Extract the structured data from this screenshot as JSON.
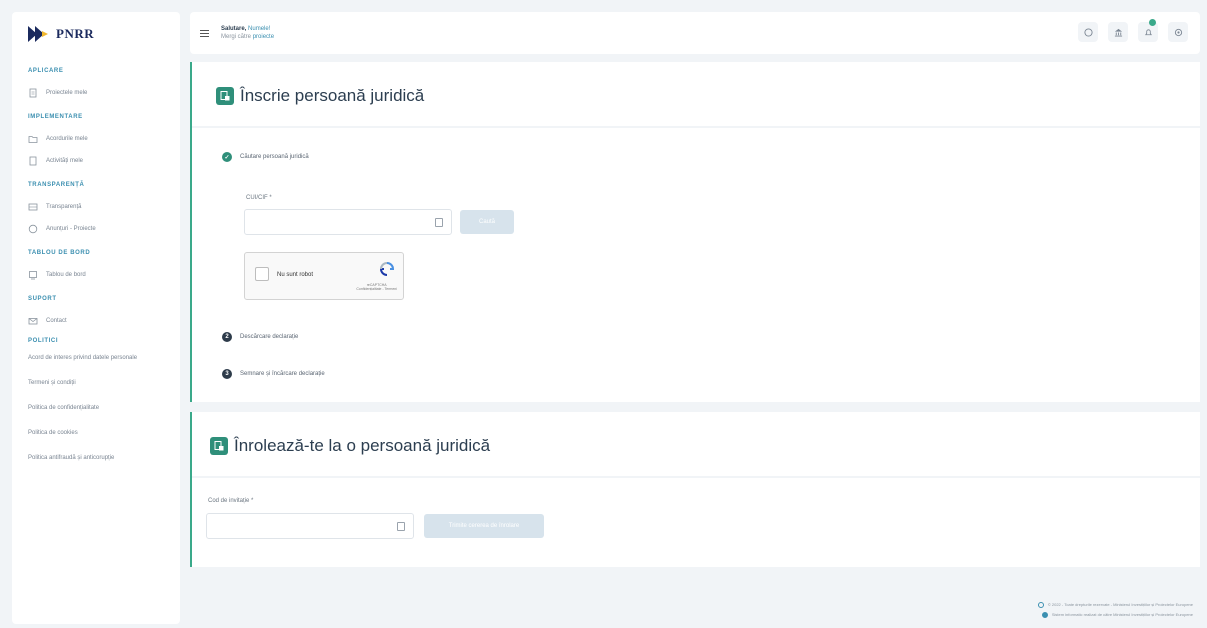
{
  "brand": {
    "logo_text": "PNRR"
  },
  "sidebar": {
    "sections": [
      {
        "title": "APLICARE",
        "items": [
          {
            "label": "Proiectele mele",
            "icon": "file-icon"
          }
        ]
      },
      {
        "title": "IMPLEMENTARE",
        "items": [
          {
            "label": "Acordurile mele",
            "icon": "folder-icon"
          },
          {
            "label": "Activități mele",
            "icon": "document-icon"
          }
        ]
      },
      {
        "title": "TRANSPARENȚĂ",
        "items": [
          {
            "label": "Transparență",
            "icon": "table-icon"
          },
          {
            "label": "Anunțuri - Proiecte",
            "icon": "info-icon"
          }
        ]
      },
      {
        "title": "TABLOU DE BORD",
        "items": [
          {
            "label": "Tablou de bord",
            "icon": "dashboard-icon"
          }
        ]
      },
      {
        "title": "SUPORT",
        "items": [
          {
            "label": "Contact",
            "icon": "mail-icon"
          }
        ]
      }
    ],
    "policies_title": "POLITICI",
    "policies": [
      "Acord de interes privind datele personale",
      "Termeni și condiții",
      "Politica de confidențialitate",
      "Politica de cookies",
      "Politica antifraudă și anticorupție"
    ]
  },
  "topbar": {
    "greeting_hello": "Salutare,",
    "greeting_name": "Numele!",
    "sub_text": "Mergi către",
    "sub_link": "proiecte",
    "icons": [
      "help-icon",
      "bank-icon",
      "bell-icon",
      "settings-icon"
    ]
  },
  "card1": {
    "title": "Înscrie persoană juridică",
    "step1_label": "Căutare persoană juridică",
    "cui_label": "CUI/CIF *",
    "search_button": "Caută",
    "captcha_label": "Nu sunt robot",
    "captcha_brand": "reCAPTCHA",
    "captcha_links": "Confidențialitate - Termeni",
    "step2_number": "2",
    "step2_label": "Descărcare declarație",
    "step3_number": "3",
    "step3_label": "Semnare și încărcare declarație"
  },
  "card2": {
    "title": "Înrolează-te la o persoană juridică",
    "invite_label": "Cod de invitație *",
    "send_button": "Trimite cererea de înrolare"
  },
  "footer": {
    "line1": "© 2022 - Toate drepturile rezervate - Ministerul Investițiilor și Proiectelor Europene",
    "line2": "Sistem informatic realizat de către Ministerul Investițiilor și Proiectelor Europene"
  },
  "colors": {
    "accent": "#3aa98a",
    "brand_dark": "#1b2a5e",
    "link": "#3b8fb0"
  }
}
